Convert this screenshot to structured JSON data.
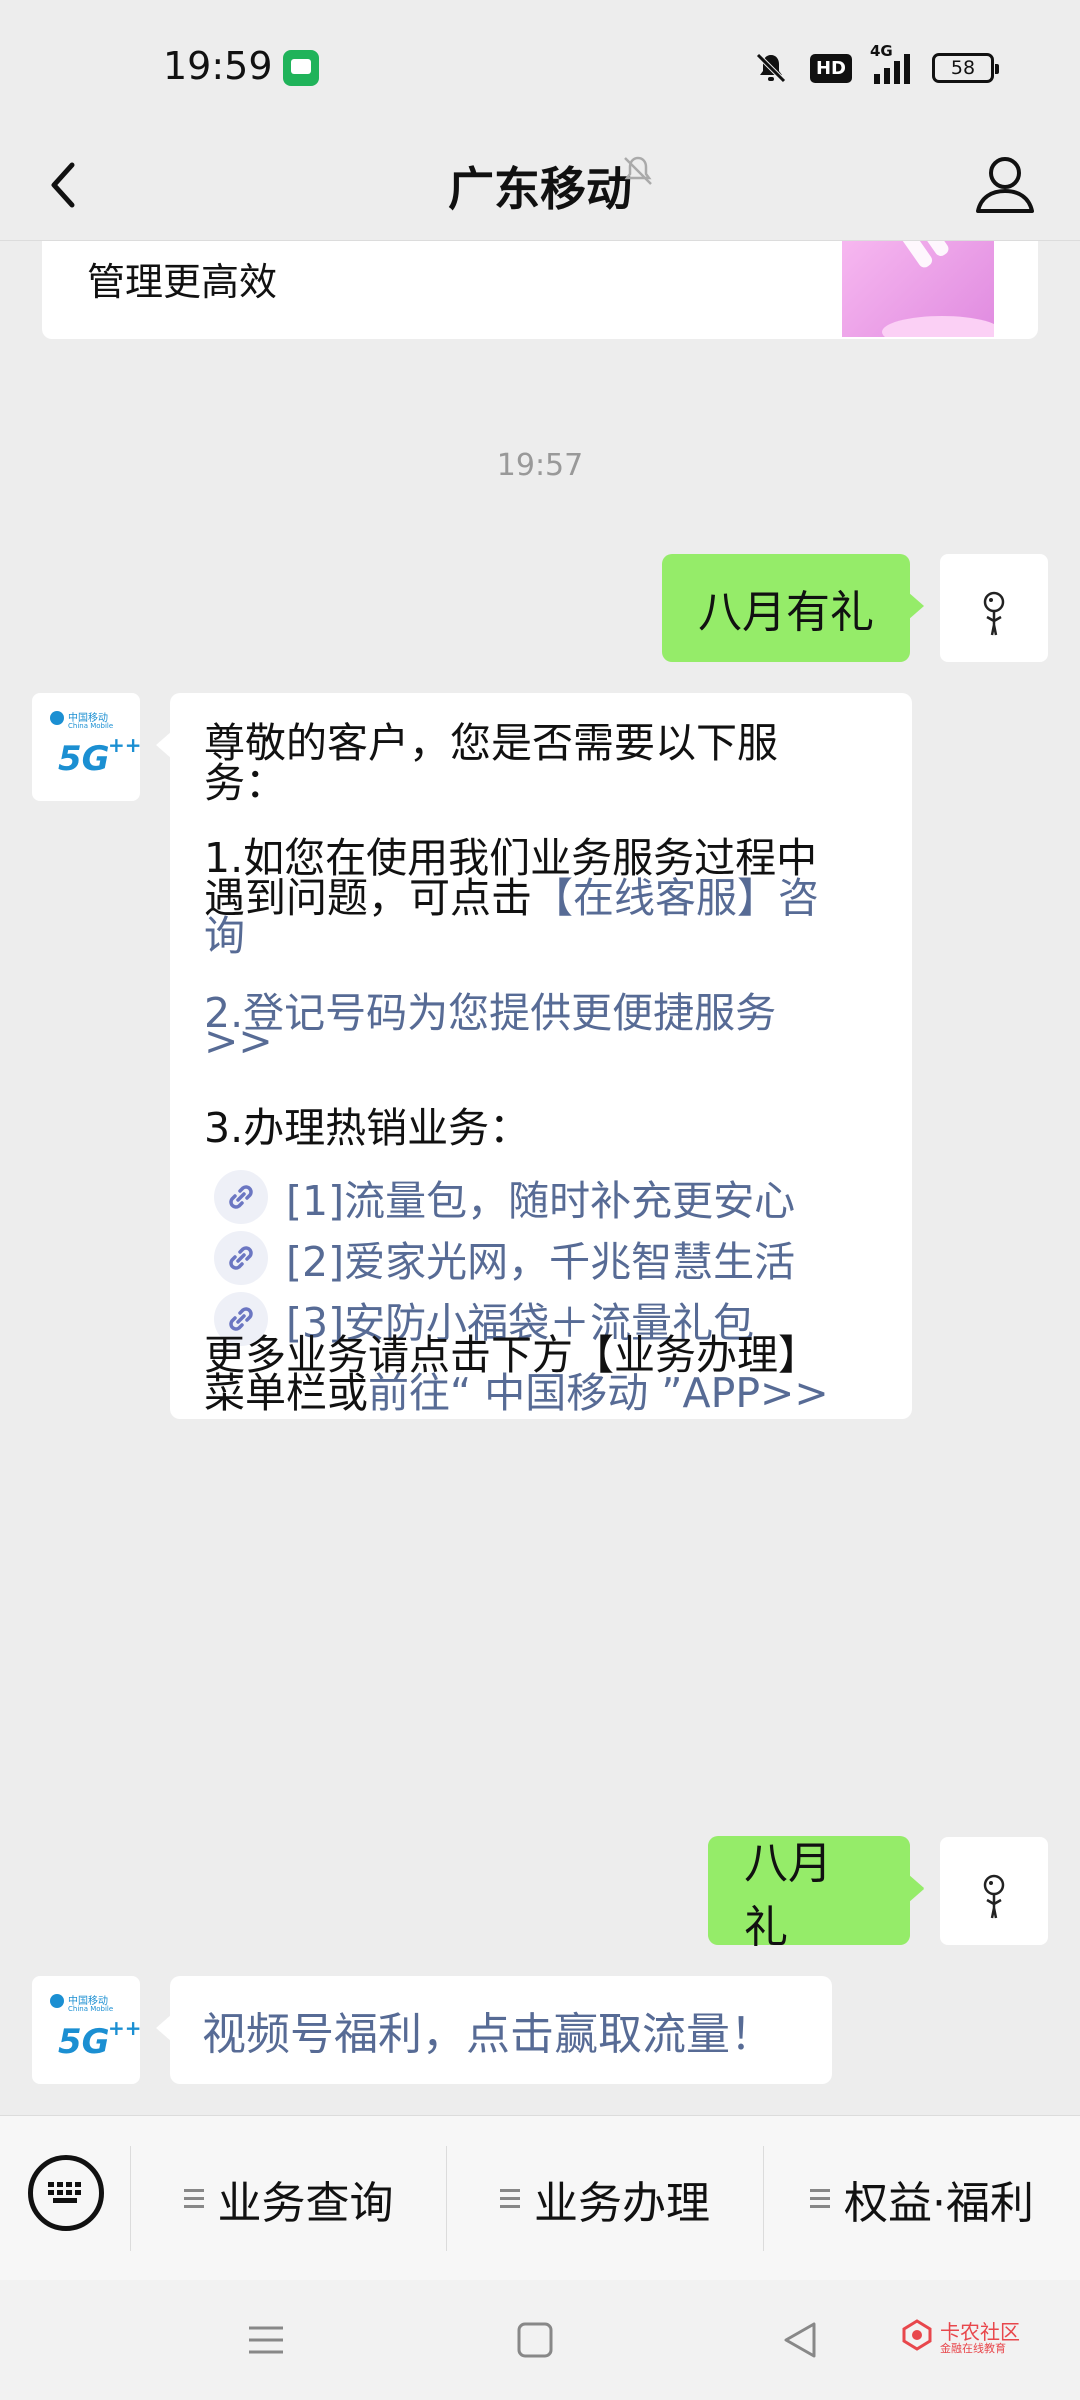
{
  "status_bar": {
    "time": "19:59",
    "hd": "HD",
    "network": "4G",
    "battery": "58",
    "icons": [
      "message-notification-icon",
      "bell-off-icon",
      "hd-voice-icon",
      "signal-icon",
      "battery-icon"
    ]
  },
  "header": {
    "title": "广东移动"
  },
  "chat": {
    "prev_card_text": "管理更高效",
    "timestamp": "19:57",
    "messages": [
      {
        "side": "right",
        "text": "八月有礼"
      },
      {
        "side": "left",
        "lines": {
          "l1": "尊敬的客户，您是否需要以下服",
          "l2": "务：",
          "l3": "1.如您在使用我们业务服务过程中",
          "l4a": "遇到问题，可点击",
          "l4b": "【在线客服】咨",
          "l5": "询",
          "l6": "2.登记号码为您提供更便捷服务",
          "l7": ">>",
          "l8": "3.办理热销业务：",
          "item1": "[1]流量包，随时补充更安心",
          "item2": "[2]爱家光网，千兆智慧生活",
          "item3": "[3]安防小福袋＋流量礼包",
          "l9": "更多业务请点击下方【业务办理】",
          "l10a": "菜单栏或",
          "l10b": "前往“ 中国移动 ”APP>>"
        }
      },
      {
        "side": "right",
        "text": "八月礼"
      },
      {
        "side": "left",
        "text": "视频号福利，点击赢取流量！"
      }
    ]
  },
  "menu": {
    "items": [
      "业务查询",
      "业务办理",
      "权益·福利"
    ]
  },
  "watermark": {
    "name": "卡农社区",
    "sub": "金融在线教育"
  },
  "colors": {
    "background": "#ededed",
    "green_bubble": "#95ec69",
    "link": "#576b95",
    "brand": "#1b8fd2"
  }
}
